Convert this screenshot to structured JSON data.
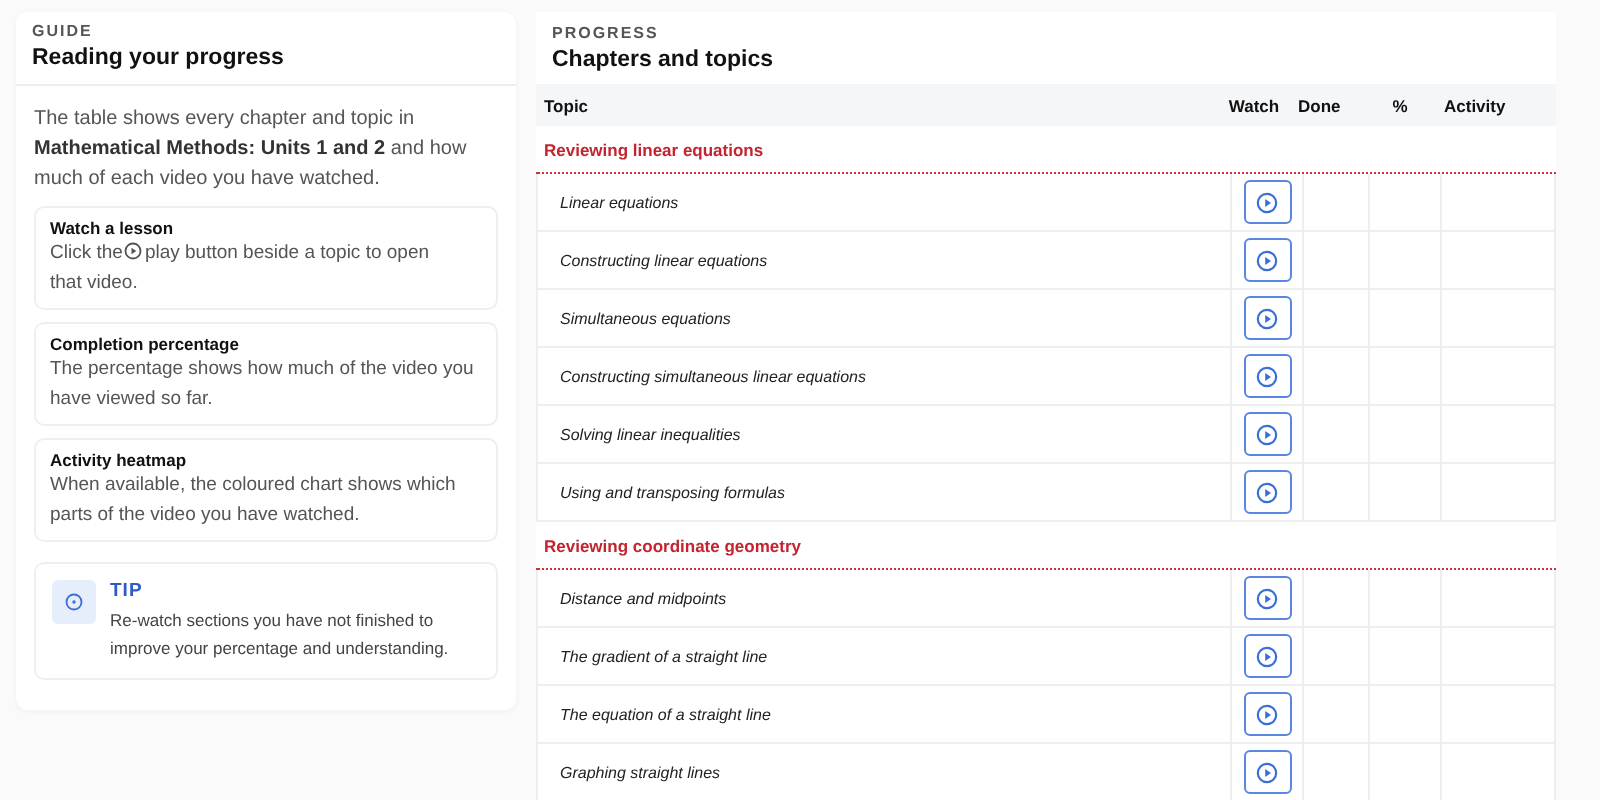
{
  "guide": {
    "eyebrow": "GUIDE",
    "title": "Reading your progress",
    "intro": "The table shows every chapter and topic in **Mathematical Methods: Units 1 and 2** and how much of each video you have watched.",
    "cards": [
      {
        "kind": "play",
        "title": "Watch a lesson",
        "body_before": "Click the",
        "body_after": "play button beside a topic to open",
        "body_line2": "that video."
      },
      {
        "kind": "plain",
        "title": "Completion percentage",
        "body": "The percentage shows how much of the video you have viewed so far."
      },
      {
        "kind": "plain",
        "title": "Activity heatmap",
        "body": "When available, the coloured chart shows which parts of the video you have watched."
      }
    ],
    "tip": {
      "label": "TIP",
      "body": "Re-watch sections you have not finished to improve your percentage and understanding."
    }
  },
  "progress": {
    "eyebrow": "PROGRESS",
    "title": "Chapters and topics",
    "columns": [
      "Topic",
      "Watch",
      "Done",
      "%",
      "Activity"
    ],
    "chapters": [
      {
        "title": "Reviewing linear equations",
        "topics": [
          "Linear equations",
          "Constructing linear equations",
          "Simultaneous equations",
          "Constructing simultaneous linear equations",
          "Solving linear inequalities",
          "Using and transposing formulas"
        ]
      },
      {
        "title": "Reviewing coordinate geometry",
        "topics": [
          "Distance and midpoints",
          "The gradient of a straight line",
          "The equation of a straight line",
          "Graphing straight lines"
        ]
      }
    ]
  }
}
